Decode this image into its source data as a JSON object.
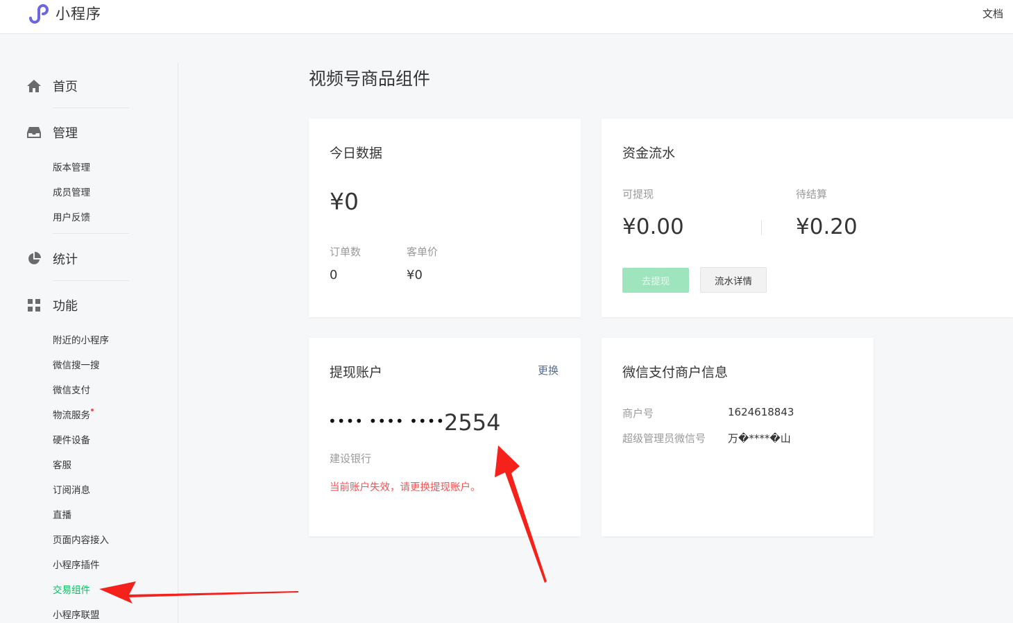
{
  "app": {
    "title": "小程序",
    "docs_link": "文档"
  },
  "sidebar": {
    "home": {
      "label": "首页",
      "icon": "home-icon"
    },
    "manage": {
      "label": "管理",
      "icon": "inbox-icon",
      "items": [
        "版本管理",
        "成员管理",
        "用户反馈"
      ]
    },
    "stats": {
      "label": "统计",
      "icon": "pie-chart-icon"
    },
    "features": {
      "label": "功能",
      "icon": "grid-icon",
      "items": [
        "附近的小程序",
        "微信搜一搜",
        "微信支付",
        "物流服务",
        "硬件设备",
        "客服",
        "订阅消息",
        "直播",
        "页面内容接入",
        "小程序插件",
        "交易组件",
        "小程序联盟"
      ],
      "active": "交易组件",
      "badge_on": "物流服务"
    }
  },
  "main": {
    "page_title": "视频号商品组件",
    "today": {
      "title": "今日数据",
      "total": "¥0",
      "orders_label": "订单数",
      "orders_value": "0",
      "avg_label": "客单价",
      "avg_value": "¥0"
    },
    "flow": {
      "title": "资金流水",
      "withdrawable_label": "可提现",
      "withdrawable_value": "¥0.00",
      "pending_label": "待结算",
      "pending_value": "¥0.20",
      "withdraw_button": "去提现",
      "details_button": "流水详情"
    },
    "account": {
      "title": "提现账户",
      "change_link": "更换",
      "masked_groups": "•••• •••• ••••",
      "last4": "2554",
      "bank": "建设银行",
      "warning": "当前账户失效，请更换提现账户。"
    },
    "merchant": {
      "title": "微信支付商户信息",
      "merchant_id_label": "商户号",
      "merchant_id_value": "1624618843",
      "admin_label": "超级管理员微信号",
      "admin_value": "万�****�山"
    }
  },
  "colors": {
    "accent_green": "#07c160",
    "disabled_green": "#9ee4bd",
    "warning_red": "#fa5151",
    "link_blue": "#576b95",
    "annotation_red": "#f5221b"
  }
}
